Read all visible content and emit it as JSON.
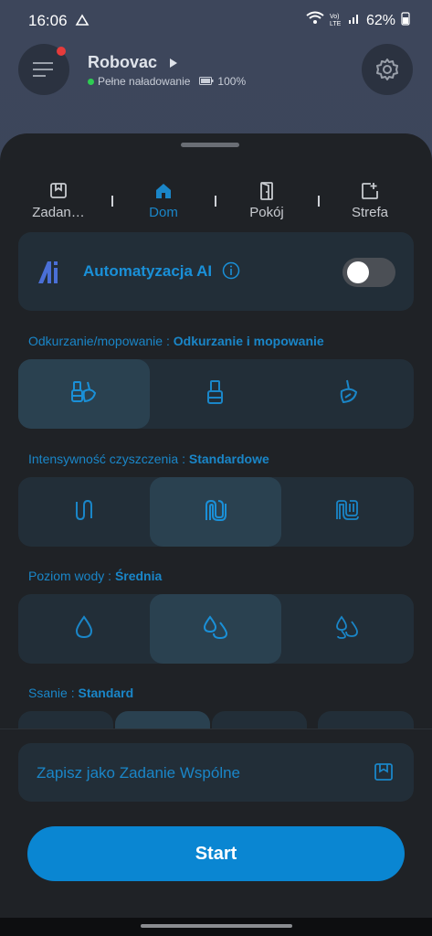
{
  "status_bar": {
    "time": "16:06",
    "network": "Vo) LTE",
    "battery": "62%"
  },
  "header": {
    "device_name": "Robovac",
    "status_text": "Pełne naładowanie",
    "battery_text": "100%"
  },
  "tabs": [
    {
      "label": "Zadan…"
    },
    {
      "label": "Dom"
    },
    {
      "label": "Pokój"
    },
    {
      "label": "Strefa"
    }
  ],
  "ai": {
    "label": "Automatyzacja AI",
    "enabled": false
  },
  "sections": {
    "mode": {
      "label": "Odkurzanie/mopowanie : ",
      "value": "Odkurzanie i mopowanie"
    },
    "intensity": {
      "label": "Intensywność czyszczenia : ",
      "value": "Standardowe"
    },
    "water": {
      "label": "Poziom wody : ",
      "value": "Średnia"
    },
    "suction": {
      "label": "Ssanie : ",
      "value": "Standard"
    }
  },
  "save_label": "Zapisz jako Zadanie Wspólne",
  "start_label": "Start",
  "colors": {
    "accent": "#1a86c8",
    "start": "#0a86d2",
    "sheet": "#1f2226"
  }
}
